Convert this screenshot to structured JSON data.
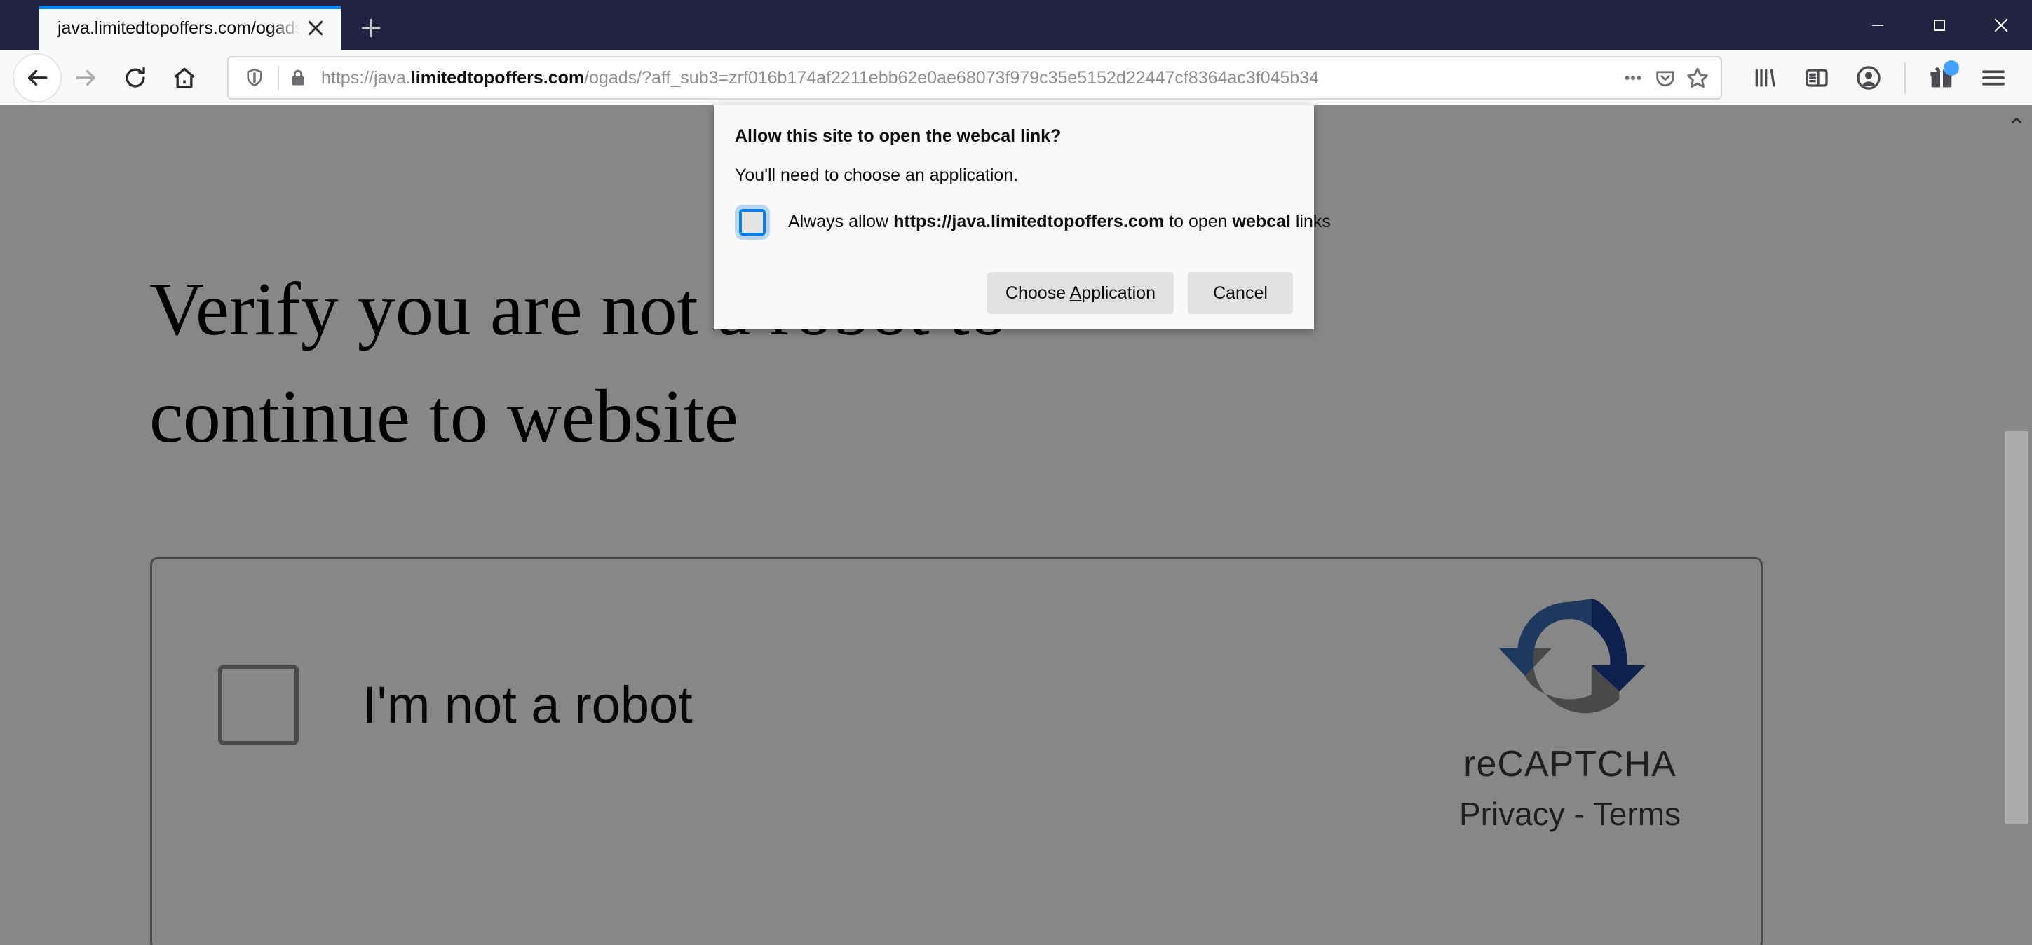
{
  "window": {
    "controls": {
      "minimize": "minimize-button",
      "maximize": "maximize-button",
      "close": "close-button"
    }
  },
  "tabs": {
    "active": {
      "title": "java.limitedtopoffers.com/ogads/?a",
      "close_label": "✕"
    },
    "new_tab_label": "+"
  },
  "toolbar": {
    "back_label": "back-arrow",
    "forward_label": "forward-arrow",
    "reload_label": "reload",
    "home_label": "home",
    "url": {
      "scheme": "https://",
      "subdomain": "java.",
      "host": "limitedtopoffers.com",
      "path": "/ogads/?aff_sub3=zrf016b174af2211ebb62e0ae68073f979c35e5152d22447cf8364ac3f045b34",
      "full": "https://java.limitedtopoffers.com/ogads/?aff_sub3=zrf016b174af2211ebb62e0ae68073f979c35e5152d22447cf8364ac3f045b34"
    },
    "icons": {
      "shield": "shield-icon",
      "lock": "lock-icon",
      "page_actions": "ellipsis-icon",
      "pocket": "pocket-icon",
      "bookmark": "star-icon",
      "library": "library-icon",
      "sidebar": "sidebar-icon",
      "account": "account-icon",
      "gift": "gift-icon",
      "menu": "hamburger-menu-icon"
    }
  },
  "page": {
    "heading": "Verify you are not a robot to continue to website",
    "recaptcha": {
      "label": "I'm not a robot",
      "brand_name": "reCAPTCHA",
      "privacy": "Privacy",
      "separator": "-",
      "terms": "Terms",
      "links": "Privacy - Terms"
    }
  },
  "dialog": {
    "title": "Allow this site to open the webcal link?",
    "description": "You'll need to choose an application.",
    "checkbox": {
      "checked": false,
      "text_before": "Always allow ",
      "origin": "https://java.limitedtopoffers.com",
      "text_middle": " to open ",
      "protocol": "webcal",
      "text_after": " links"
    },
    "buttons": {
      "primary_pre": "Choose ",
      "primary_accesskey": "A",
      "primary_post": "pplication",
      "primary_full": "Choose Application",
      "cancel": "Cancel"
    }
  },
  "colors": {
    "titlebar": "#20223f",
    "toolbar": "#f9f9fa",
    "tab_accent": "#0a84ff",
    "dialog_bg": "#f9f9fa",
    "button_bg": "#e1e1e1",
    "checkbox_focus": "#0a7fe8",
    "recaptcha_blue_light": "#3a6cb5",
    "recaptcha_blue_dark": "#1c3f94",
    "recaptcha_gray": "#8a8a8a"
  }
}
